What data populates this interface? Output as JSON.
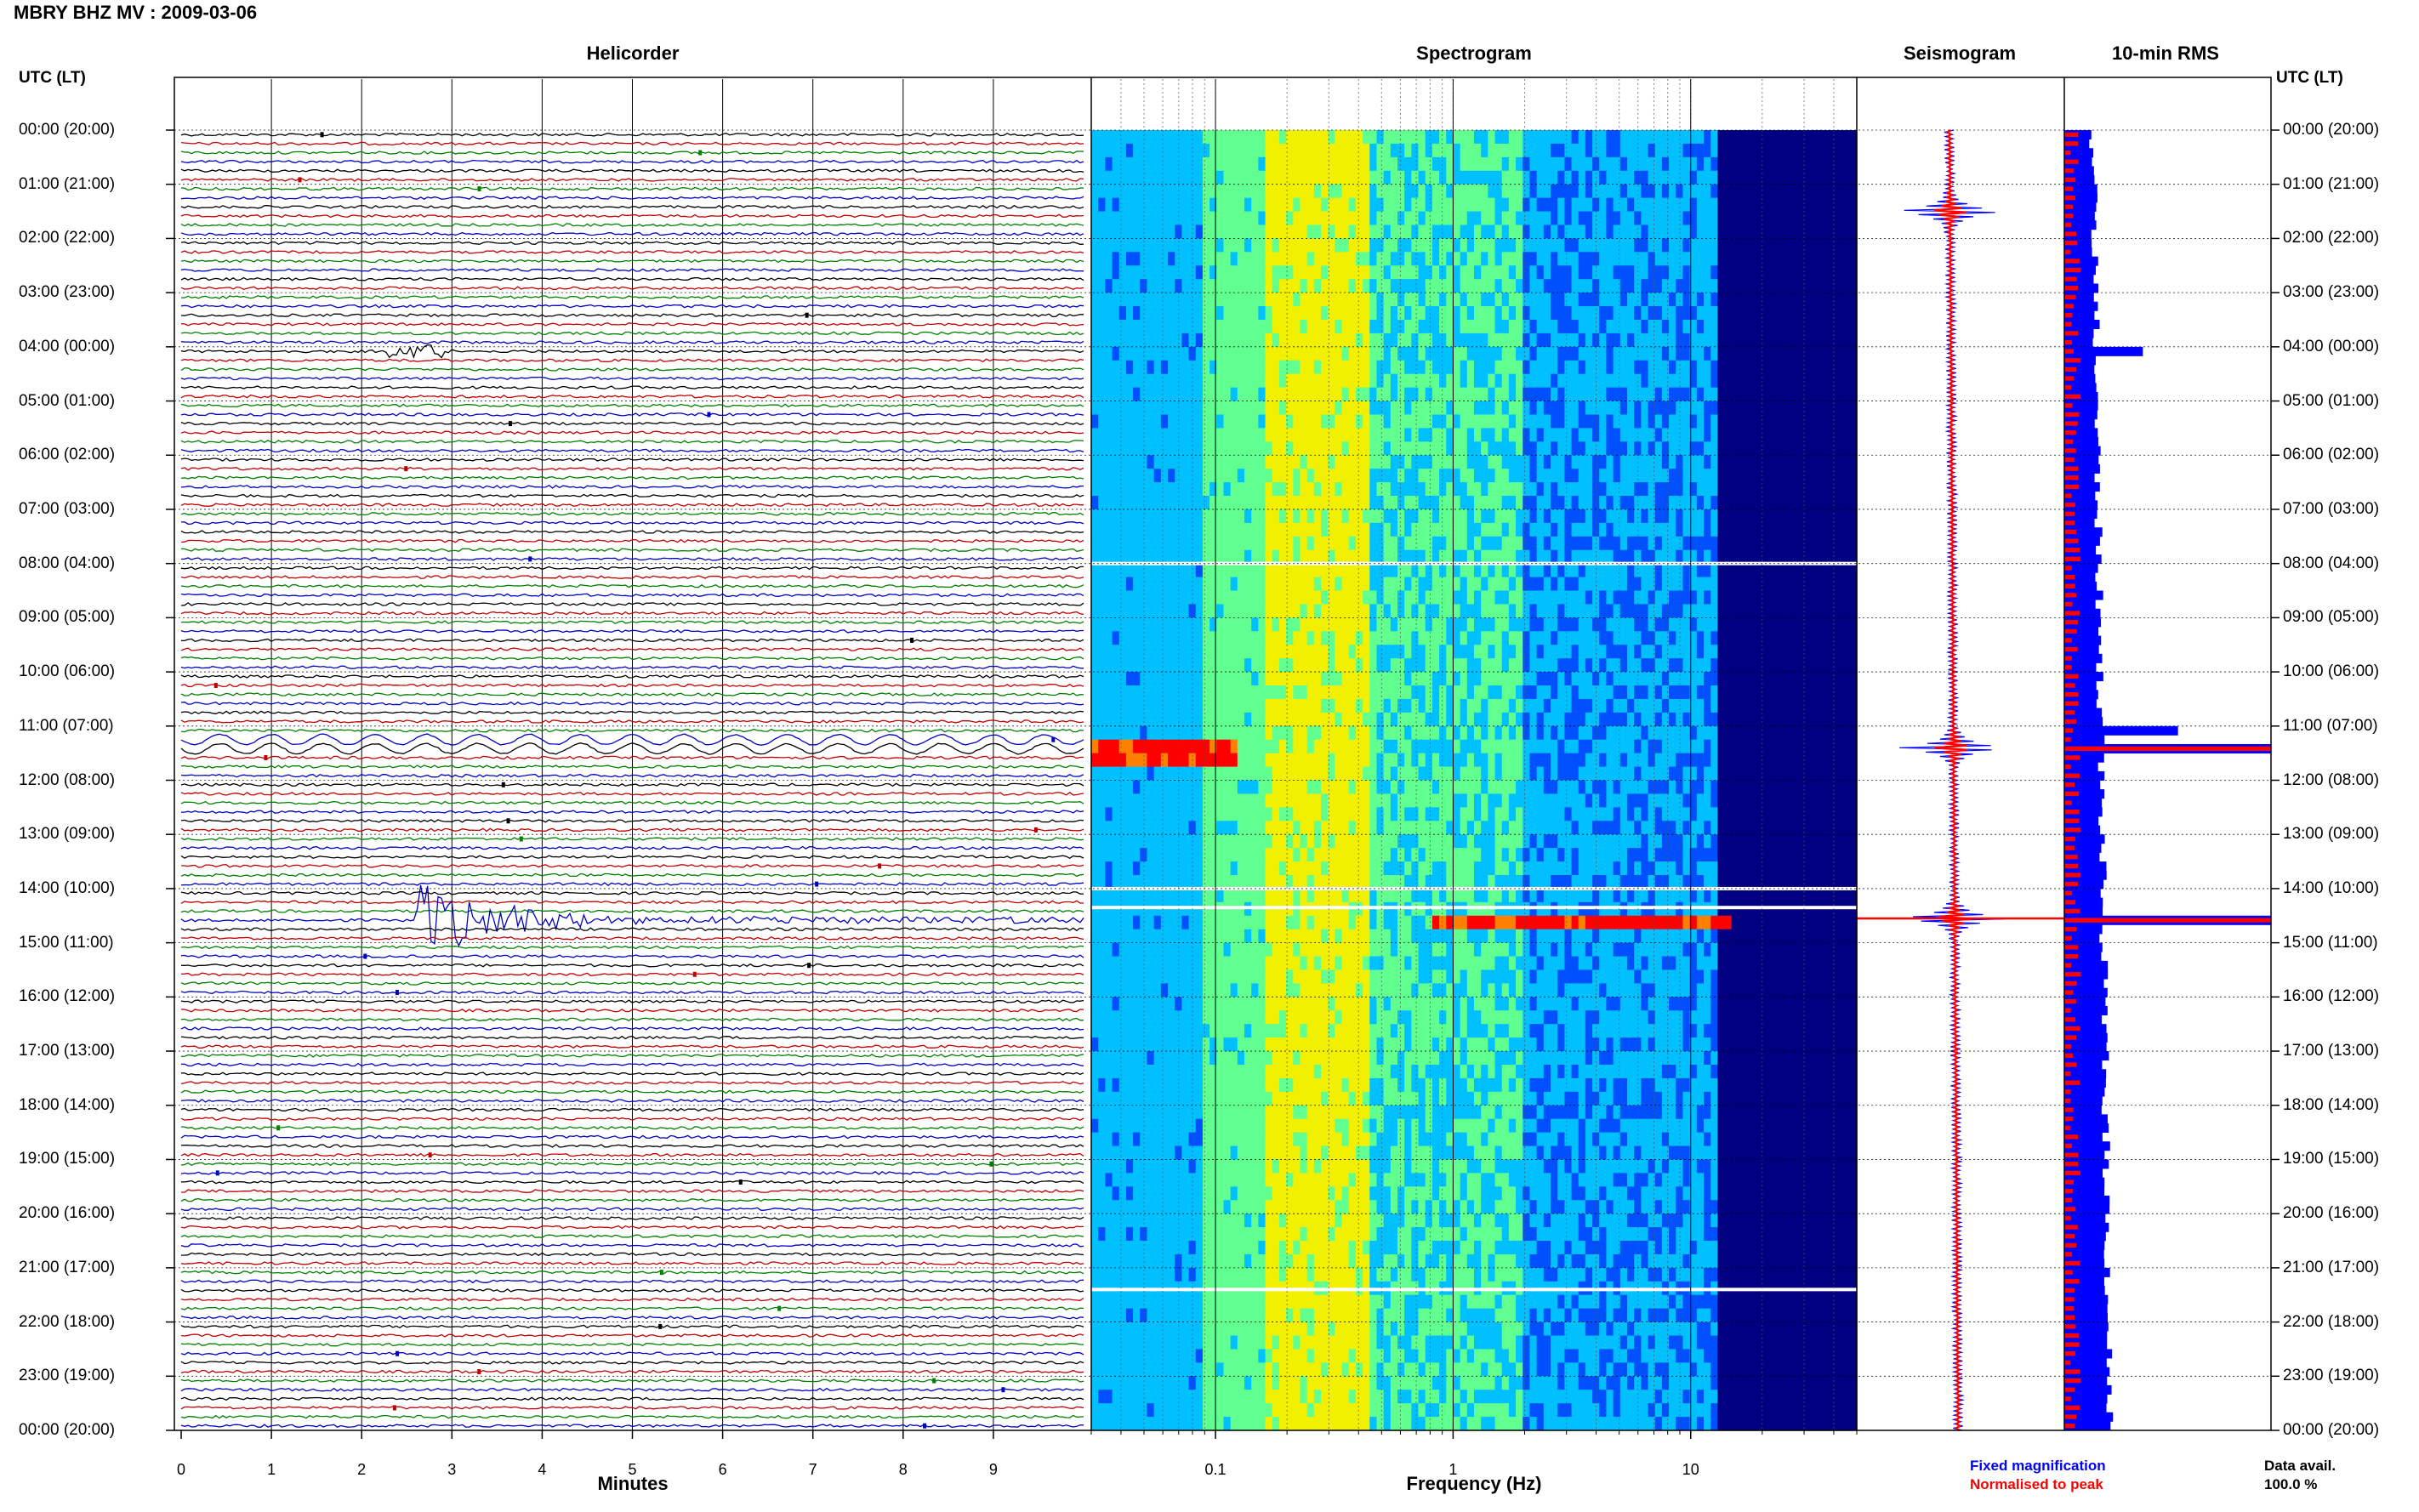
{
  "header": {
    "title": "MBRY BHZ MV : 2009-03-06",
    "left_axis_label": "UTC (LT)",
    "right_axis_label": "UTC (LT)"
  },
  "chart_data": [
    {
      "type": "line",
      "panel": "helicorder",
      "title": "Helicorder",
      "xlabel": "Minutes",
      "x_ticks": [
        "0",
        "1",
        "2",
        "3",
        "4",
        "5",
        "6",
        "7",
        "8",
        "9"
      ],
      "xlim": [
        0,
        10
      ],
      "rows_per_hour": 6,
      "trace_colors": [
        "#000000",
        "#c00000",
        "#008000",
        "#0000c0"
      ],
      "row_labels": [
        "00:00 (20:00)",
        "01:00 (21:00)",
        "02:00 (22:00)",
        "03:00 (23:00)",
        "04:00 (00:00)",
        "05:00 (01:00)",
        "06:00 (02:00)",
        "07:00 (03:00)",
        "08:00 (04:00)",
        "09:00 (05:00)",
        "10:00 (06:00)",
        "11:00 (07:00)",
        "12:00 (08:00)",
        "13:00 (09:00)",
        "14:00 (10:00)",
        "15:00 (11:00)",
        "16:00 (12:00)",
        "17:00 (13:00)",
        "18:00 (14:00)",
        "19:00 (15:00)",
        "20:00 (16:00)",
        "21:00 (17:00)",
        "22:00 (18:00)",
        "23:00 (19:00)",
        "00:00 (20:00)"
      ],
      "events": [
        {
          "hour": 4.0,
          "minute_start": 2.3,
          "minute_end": 3.0,
          "amplitude": "small"
        },
        {
          "hour": 11.25,
          "minute_start": 0,
          "minute_end": 10,
          "amplitude": "long-period"
        },
        {
          "hour": 14.5,
          "minute_start": 2.6,
          "minute_end": 10,
          "amplitude": "large"
        }
      ]
    },
    {
      "type": "heatmap",
      "panel": "spectrogram",
      "title": "Spectrogram",
      "xlabel": "Frequency (Hz)",
      "x_scale": "log",
      "x_ticks": [
        "0.1",
        "1",
        "10"
      ],
      "xlim": [
        0.03,
        50
      ],
      "colormap": [
        "#000080",
        "#0050ff",
        "#00c0ff",
        "#60ff90",
        "#f0f000",
        "#ff8000",
        "#ff0000"
      ],
      "data_gaps_utc_hour": [
        8.0,
        14.0,
        14.35,
        21.4
      ],
      "events": [
        {
          "hour": 11.4,
          "f_min": 0.03,
          "f_max": 0.12
        },
        {
          "hour": 14.5,
          "f_min": 0.8,
          "f_max": 15
        }
      ]
    },
    {
      "type": "line",
      "panel": "seismogram",
      "title": "Seismogram",
      "series": [
        {
          "name": "Fixed magnification",
          "color": "#0000ff"
        },
        {
          "name": "Normalised to peak",
          "color": "#ff0000"
        }
      ],
      "peaks_utc_hour": [
        1.5,
        11.4,
        14.55
      ]
    },
    {
      "type": "bar",
      "panel": "rms",
      "title": "10-min RMS",
      "series": [
        {
          "name": "Fixed magnification",
          "color": "#0000ff"
        },
        {
          "name": "Normalised to peak",
          "color": "#ff0000"
        }
      ],
      "spikes": [
        {
          "hour": 4.0,
          "value": 0.38
        },
        {
          "hour": 11.0,
          "value": 0.55
        },
        {
          "hour": 11.4,
          "value": 1.0
        },
        {
          "hour": 14.5,
          "value": 1.0
        }
      ]
    }
  ],
  "legend": {
    "fixed_label": "Fixed magnification",
    "normalised_label": "Normalised to peak",
    "fixed_color": "#0000ff",
    "normalised_color": "#ff0000"
  },
  "data_availability": {
    "label": "Data avail.",
    "value": "100.0 %"
  }
}
